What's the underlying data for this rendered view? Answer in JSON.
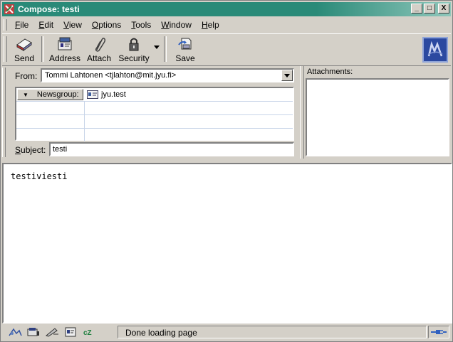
{
  "window": {
    "title": "Compose: testi",
    "controls": {
      "minimize": "_",
      "maximize": "□",
      "close": "X"
    }
  },
  "menu": [
    {
      "label": "File",
      "u": "F",
      "rest": "ile"
    },
    {
      "label": "Edit",
      "u": "E",
      "rest": "dit"
    },
    {
      "label": "View",
      "u": "V",
      "rest": "iew"
    },
    {
      "label": "Options",
      "u": "O",
      "rest": "ptions"
    },
    {
      "label": "Tools",
      "u": "T",
      "rest": "ools"
    },
    {
      "label": "Window",
      "u": "W",
      "rest": "indow"
    },
    {
      "label": "Help",
      "u": "H",
      "rest": "elp"
    }
  ],
  "toolbar": {
    "send": "Send",
    "address": "Address",
    "attach": "Attach",
    "security": "Security",
    "save": "Save"
  },
  "from": {
    "label": "From:",
    "value": "Tommi Lahtonen <tjlahton@mit.jyu.fi>"
  },
  "recipients": {
    "rows": [
      {
        "type": "Newsgroup:",
        "value": "jyu.test"
      },
      {
        "type": "",
        "value": ""
      },
      {
        "type": "",
        "value": ""
      },
      {
        "type": "",
        "value": ""
      }
    ]
  },
  "subject": {
    "label_u": "S",
    "label_rest": "ubject:",
    "value": "testi"
  },
  "attachments": {
    "label": "Attachments:"
  },
  "body": {
    "text": "testiviesti"
  },
  "status": {
    "text": "Done loading page"
  },
  "colors": {
    "titlebar": "#2a8a78",
    "logo": "#2b49a0"
  }
}
